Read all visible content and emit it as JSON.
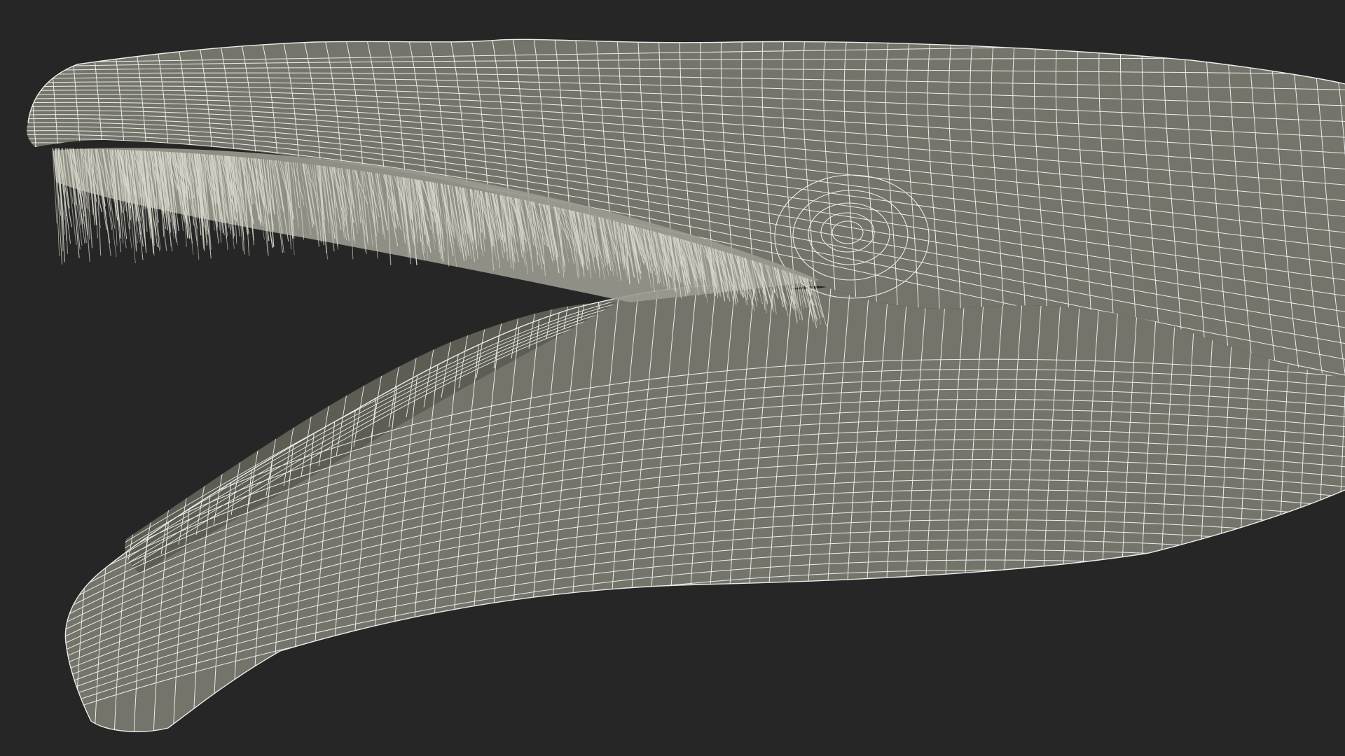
{
  "scene": {
    "subject": "whale-head-wireframe",
    "background_color": "#262626",
    "mesh_fill_color": "#74746a",
    "mesh_fill_shadow_color": "#5d5d54",
    "mesh_wire_color": "#ececec",
    "baleen_color": "#d9d8cc",
    "interior_color": "#3b3b36"
  }
}
